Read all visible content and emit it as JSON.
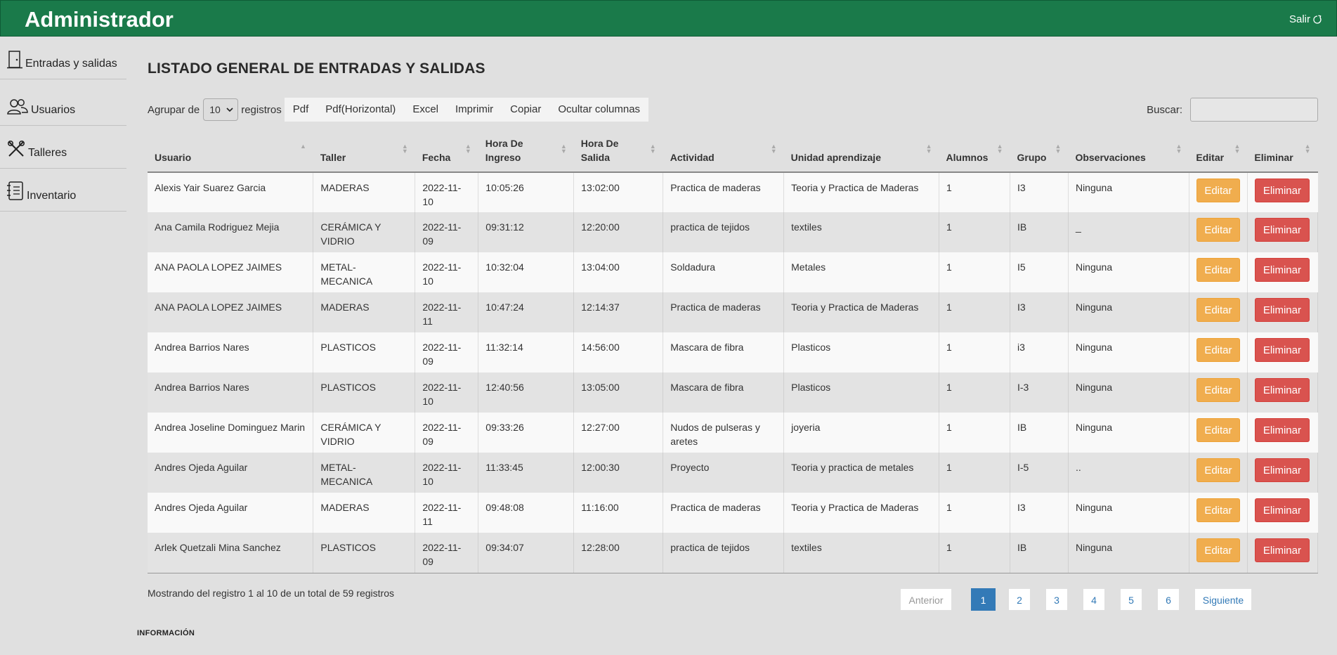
{
  "header": {
    "title": "Administrador",
    "logout_label": "Salir"
  },
  "sidebar": {
    "items": [
      {
        "label": "Entradas y salidas",
        "icon": "door-icon"
      },
      {
        "label": "Usuarios",
        "icon": "users-icon"
      },
      {
        "label": "Talleres",
        "icon": "tools-icon"
      },
      {
        "label": "Inventario",
        "icon": "notebook-icon"
      }
    ]
  },
  "main": {
    "title": "LISTADO GENERAL DE ENTRADAS Y SALIDAS",
    "group_prefix": "Agrupar de",
    "group_value": "10",
    "group_suffix": "registros",
    "export_buttons": [
      "Pdf",
      "Pdf(Horizontal)",
      "Excel",
      "Imprimir",
      "Copiar",
      "Ocultar columnas"
    ],
    "search_label": "Buscar:",
    "search_value": ""
  },
  "table": {
    "columns": [
      "Usuario",
      "Taller",
      "Fecha",
      "Hora De Ingreso",
      "Hora De Salida",
      "Actividad",
      "Unidad aprendizaje",
      "Alumnos",
      "Grupo",
      "Observaciones",
      "Editar",
      "Eliminar"
    ],
    "edit_label": "Editar",
    "delete_label": "Eliminar",
    "rows": [
      [
        "Alexis Yair Suarez Garcia",
        "MADERAS",
        "2022-11-10",
        "10:05:26",
        "13:02:00",
        "Practica de maderas",
        "Teoria y Practica de Maderas",
        "1",
        "I3",
        "Ninguna"
      ],
      [
        "Ana Camila Rodriguez Mejia",
        "CERÁMICA Y VIDRIO",
        "2022-11-09",
        "09:31:12",
        "12:20:00",
        "practica de tejidos",
        "textiles",
        "1",
        "IB",
        "_"
      ],
      [
        "ANA PAOLA LOPEZ JAIMES",
        "METAL-MECANICA",
        "2022-11-10",
        "10:32:04",
        "13:04:00",
        "Soldadura",
        "Metales",
        "1",
        "I5",
        "Ninguna"
      ],
      [
        "ANA PAOLA LOPEZ JAIMES",
        "MADERAS",
        "2022-11-11",
        "10:47:24",
        "12:14:37",
        "Practica de maderas",
        "Teoria y Practica de Maderas",
        "1",
        "I3",
        "Ninguna"
      ],
      [
        "Andrea Barrios Nares",
        "PLASTICOS",
        "2022-11-09",
        "11:32:14",
        "14:56:00",
        "Mascara de fibra",
        "Plasticos",
        "1",
        "i3",
        "Ninguna"
      ],
      [
        "Andrea Barrios Nares",
        "PLASTICOS",
        "2022-11-10",
        "12:40:56",
        "13:05:00",
        "Mascara de fibra",
        "Plasticos",
        "1",
        "I-3",
        "Ninguna"
      ],
      [
        "Andrea Joseline Dominguez Marin",
        "CERÁMICA Y VIDRIO",
        "2022-11-09",
        "09:33:26",
        "12:27:00",
        "Nudos de pulseras y aretes",
        "joyeria",
        "1",
        "IB",
        "Ninguna"
      ],
      [
        "Andres Ojeda Aguilar",
        "METAL-MECANICA",
        "2022-11-10",
        "11:33:45",
        "12:00:30",
        "Proyecto",
        "Teoria y practica de metales",
        "1",
        "I-5",
        ".."
      ],
      [
        "Andres Ojeda Aguilar",
        "MADERAS",
        "2022-11-11",
        "09:48:08",
        "11:16:00",
        "Practica de maderas",
        "Teoria y Practica de Maderas",
        "1",
        "I3",
        "Ninguna"
      ],
      [
        "Arlek Quetzali Mina Sanchez",
        "PLASTICOS",
        "2022-11-09",
        "09:34:07",
        "12:28:00",
        "practica de tejidos",
        "textiles",
        "1",
        "IB",
        "Ninguna"
      ]
    ]
  },
  "footer": {
    "info": "Mostrando del registro 1 al 10 de un total de 59 registros",
    "prev": "Anterior",
    "pages": [
      "1",
      "2",
      "3",
      "4",
      "5",
      "6"
    ],
    "active_page": "1",
    "next": "Siguiente",
    "section_label": "INFORMACIÓN"
  },
  "colors": {
    "header_bg": "#1a7a4a",
    "edit_button": "#f0ad4e",
    "delete_button": "#d9534f",
    "active_page": "#337ab7"
  }
}
